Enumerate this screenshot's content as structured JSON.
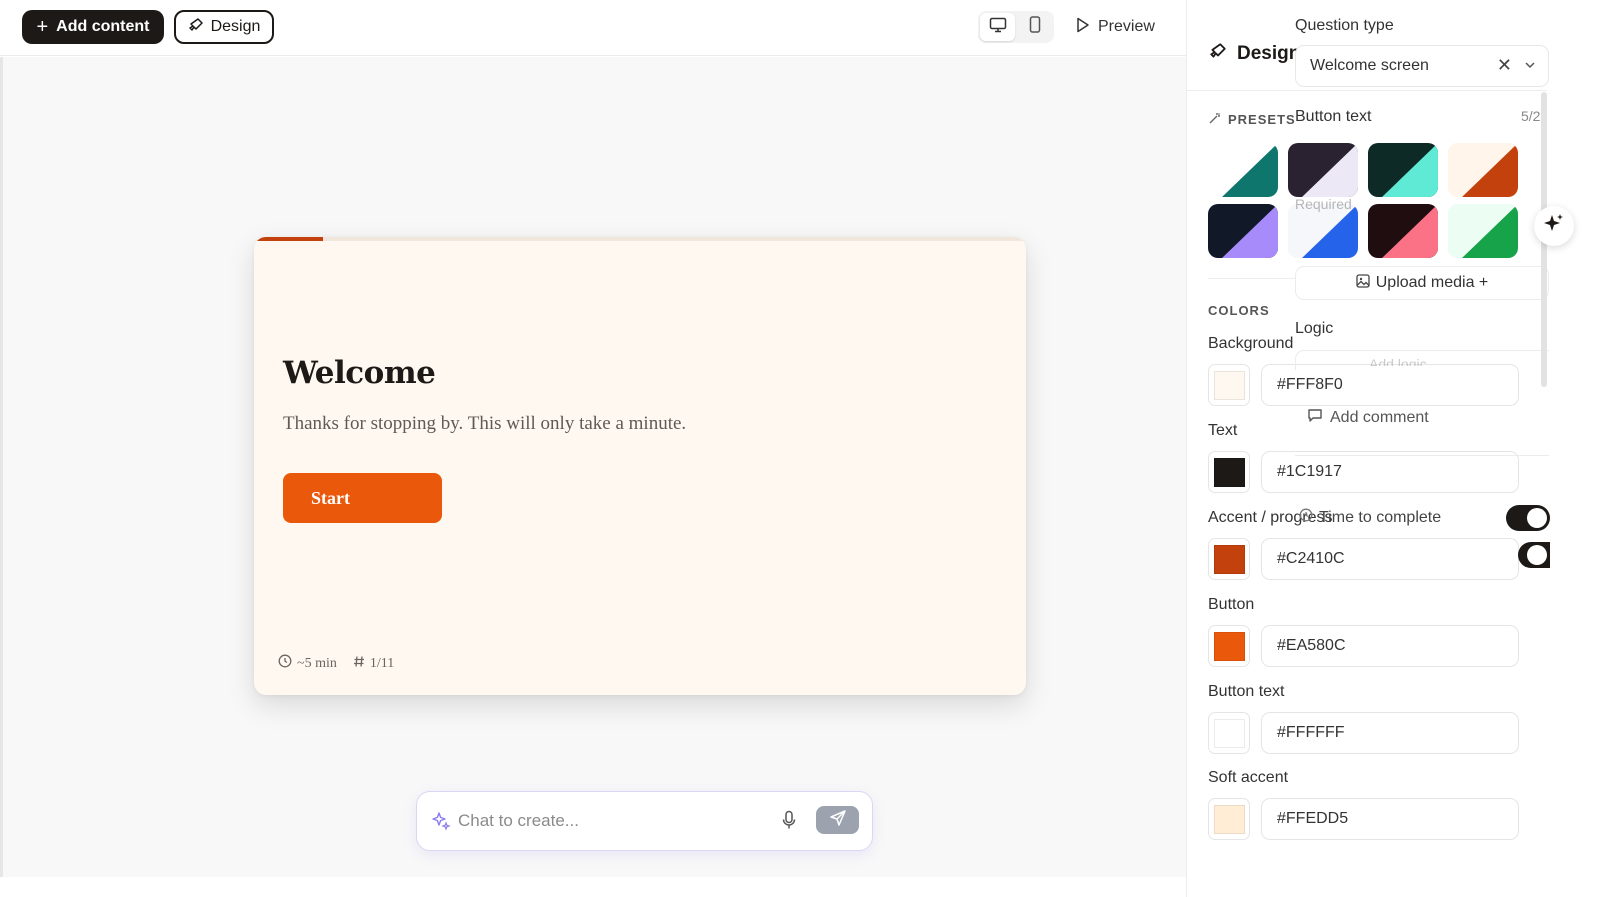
{
  "toolbar": {
    "add_content_label": "Add content",
    "design_label": "Design",
    "preview_label": "Preview",
    "icons": [
      "plus-icon",
      "brush-icon",
      "desktop-icon",
      "mobile-icon",
      "play-icon",
      "globe-icon",
      "sliders-icon"
    ]
  },
  "card": {
    "title": "Welcome",
    "description": "Thanks for stopping by. This will only take a minute.",
    "start_label": "Start",
    "time_estimate": "~5 min",
    "position": "1/11",
    "progress_fraction": 0.09
  },
  "chat": {
    "placeholder": "Chat to create..."
  },
  "design_panel": {
    "title": "Design",
    "presets_label": "PRESETS",
    "presets": [
      {
        "a": "#ffffff",
        "b": "#0f766e"
      },
      {
        "a": "#2a2230",
        "b": "#ece8f6"
      },
      {
        "a": "#0e2a26",
        "b": "#5eead4"
      },
      {
        "a": "#fff5eb",
        "b": "#c2410c"
      },
      {
        "a": "#111827",
        "b": "#a78bfa"
      },
      {
        "a": "#f5f7fb",
        "b": "#2563eb"
      },
      {
        "a": "#1f0d10",
        "b": "#fb7185"
      },
      {
        "a": "#ecfdf3",
        "b": "#16a34a"
      }
    ],
    "colors_label": "COLORS",
    "colors": [
      {
        "label": "Background",
        "value": "#FFF8F0",
        "hex": "#FFF8F0"
      },
      {
        "label": "Text",
        "value": "#1C1917",
        "hex": "#1C1917"
      },
      {
        "label": "Accent / progress",
        "value": "#C2410C",
        "hex": "#C2410C"
      },
      {
        "label": "Button",
        "value": "#EA580C",
        "hex": "#EA580C"
      },
      {
        "label": "Button text",
        "value": "#FFFFFF",
        "hex": "#FFFFFF"
      },
      {
        "label": "Soft accent",
        "value": "#FFEDD5",
        "hex": "#FFEDD5"
      }
    ]
  },
  "question_panel": {
    "question_type_label": "Question type",
    "question_type_value": "Welcome screen",
    "button_text_label": "Button text",
    "button_text_count": "5/2",
    "required_label": "Required",
    "upload_media_label": "Upload media +",
    "logic_label": "Logic",
    "add_logic_label": "Add logic",
    "add_comment_label": "Add comment",
    "time_to_complete_label": "Time to complete",
    "time_to_complete_on": true,
    "second_toggle_on": true
  }
}
